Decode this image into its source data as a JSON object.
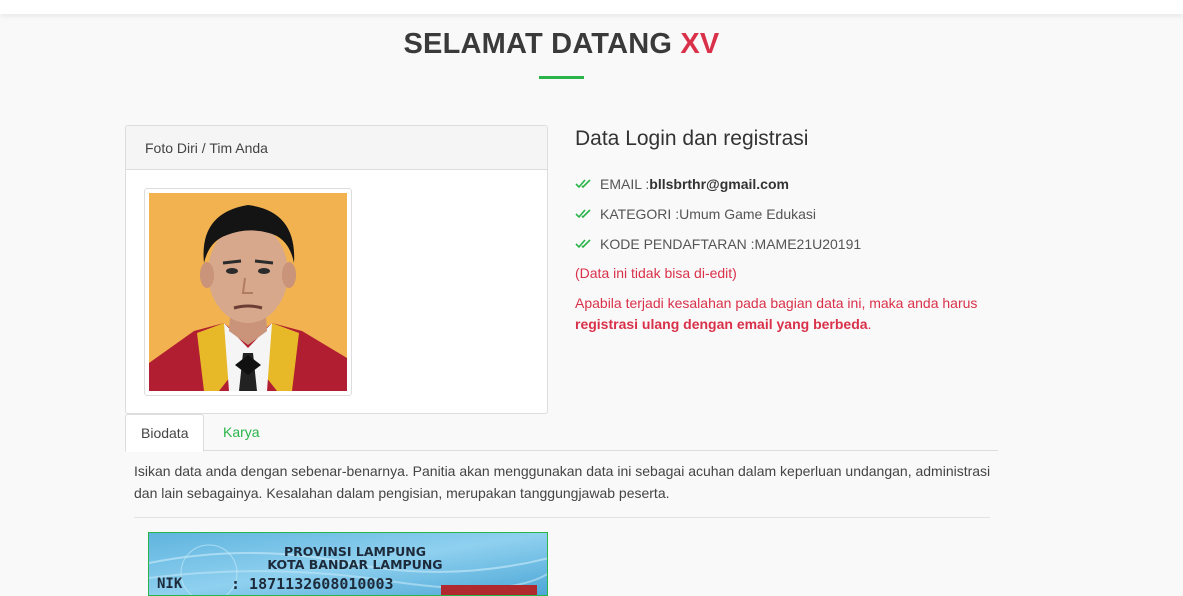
{
  "header": {
    "title_main": "SELAMAT DATANG",
    "title_accent": "XV",
    "accent_color": "#d9314a",
    "underline_color": "#2ab44a"
  },
  "photo_panel": {
    "heading": "Foto Diri / Tim Anda",
    "photo_alt": "profile-photo"
  },
  "login_info": {
    "title": "Data Login dan registrasi",
    "items": [
      {
        "label": "EMAIL : ",
        "value": "bllsbrthr@gmail.com",
        "bold": true
      },
      {
        "label": "KATEGORI : ",
        "value": "Umum Game Edukasi",
        "bold": false
      },
      {
        "label": "KODE PENDAFTARAN : ",
        "value": "MAME21U20191",
        "bold": false
      }
    ],
    "note": "(Data ini tidak bisa di-edit)",
    "warning_prefix": "Apabila terjadi kesalahan pada bagian data ini, maka anda harus ",
    "warning_bold": "registrasi ulang dengan email yang berbeda",
    "warning_suffix": "."
  },
  "tabs": [
    {
      "label": "Biodata",
      "active": true
    },
    {
      "label": "Karya",
      "active": false
    }
  ],
  "biodata": {
    "description": "Isikan data anda dengan sebenar-benarnya. Panitia akan menggunakan data ini sebagai acuhan dalam keperluan undangan, administrasi dan lain sebagainya. Kesalahan dalam pengisian, merupakan tanggungjawab peserta."
  },
  "id_card": {
    "province": "PROVINSI LAMPUNG",
    "city": "KOTA BANDAR LAMPUNG",
    "nik_label": "NIK",
    "nik_value": ": 1871132608010003"
  },
  "icons": {
    "check": "double-check-icon"
  }
}
